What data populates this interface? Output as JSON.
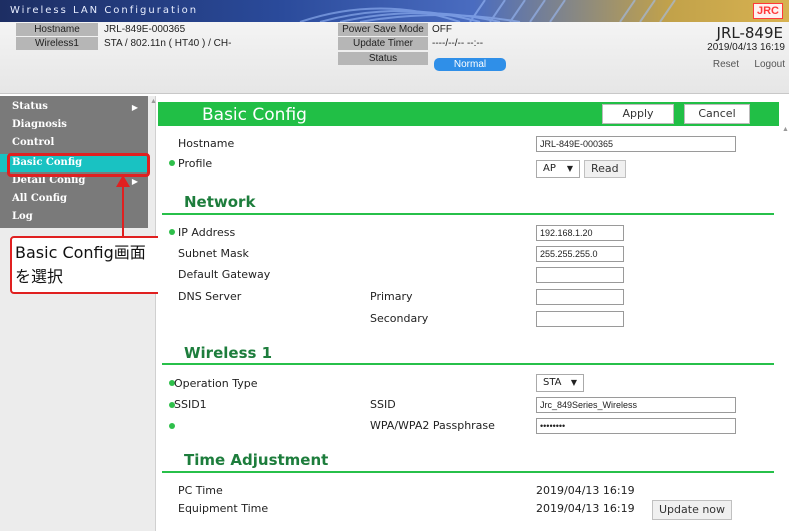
{
  "banner": {
    "title": "Wireless LAN Configuration",
    "brand": "JRC"
  },
  "info": {
    "hostname_key": "Hostname",
    "hostname_val": "JRL-849E-000365",
    "wireless_key": "Wireless1",
    "wireless_val": "STA / 802.11n ( HT40 ) / CH-",
    "psm_key": "Power Save Mode",
    "psm_val": "OFF",
    "timer_key": "Update Timer",
    "timer_val": "----/--/-- --:--",
    "status_key": "Status",
    "status_val": "Normal",
    "model": "JRL-849E",
    "datetime": "2019/04/13 16:19",
    "reset": "Reset",
    "logout": "Logout"
  },
  "sidebar": {
    "items": [
      {
        "label": "Status",
        "arrow": "▶"
      },
      {
        "label": "Diagnosis",
        "arrow": ""
      },
      {
        "label": "Control",
        "arrow": ""
      },
      {
        "label": "Basic Config",
        "arrow": ""
      },
      {
        "label": "Detail Config",
        "arrow": "▶"
      },
      {
        "label": "All Config",
        "arrow": ""
      },
      {
        "label": "Log",
        "arrow": ""
      }
    ]
  },
  "callout": {
    "line1": "Basic Config画面",
    "line2": "を選択"
  },
  "main": {
    "title": "Basic Config",
    "apply": "Apply",
    "cancel": "Cancel",
    "hostname_label": "Hostname",
    "hostname_value": "JRL-849E-000365",
    "profile_label": "Profile",
    "profile_value": "AP",
    "read": "Read",
    "network": {
      "title": "Network",
      "ip_label": "IP Address",
      "ip_value": "192.168.1.20",
      "subnet_label": "Subnet Mask",
      "subnet_value": "255.255.255.0",
      "gateway_label": "Default Gateway",
      "gateway_value": "",
      "dns_label": "DNS Server",
      "primary_label": "Primary",
      "primary_value": "",
      "secondary_label": "Secondary",
      "secondary_value": ""
    },
    "wireless": {
      "title": "Wireless 1",
      "op_label": "Operation Type",
      "op_value": "STA",
      "ssid1_label": "SSID1",
      "ssid_label": "SSID",
      "ssid_value": "Jrc_849Series_Wireless",
      "pass_label": "WPA/WPA2 Passphrase",
      "pass_value": "••••••••"
    },
    "time": {
      "title": "Time Adjustment",
      "pc_label": "PC Time",
      "pc_value": "2019/04/13 16:19",
      "eq_label": "Equipment Time",
      "eq_value": "2019/04/13 16:19",
      "update": "Update now"
    }
  }
}
